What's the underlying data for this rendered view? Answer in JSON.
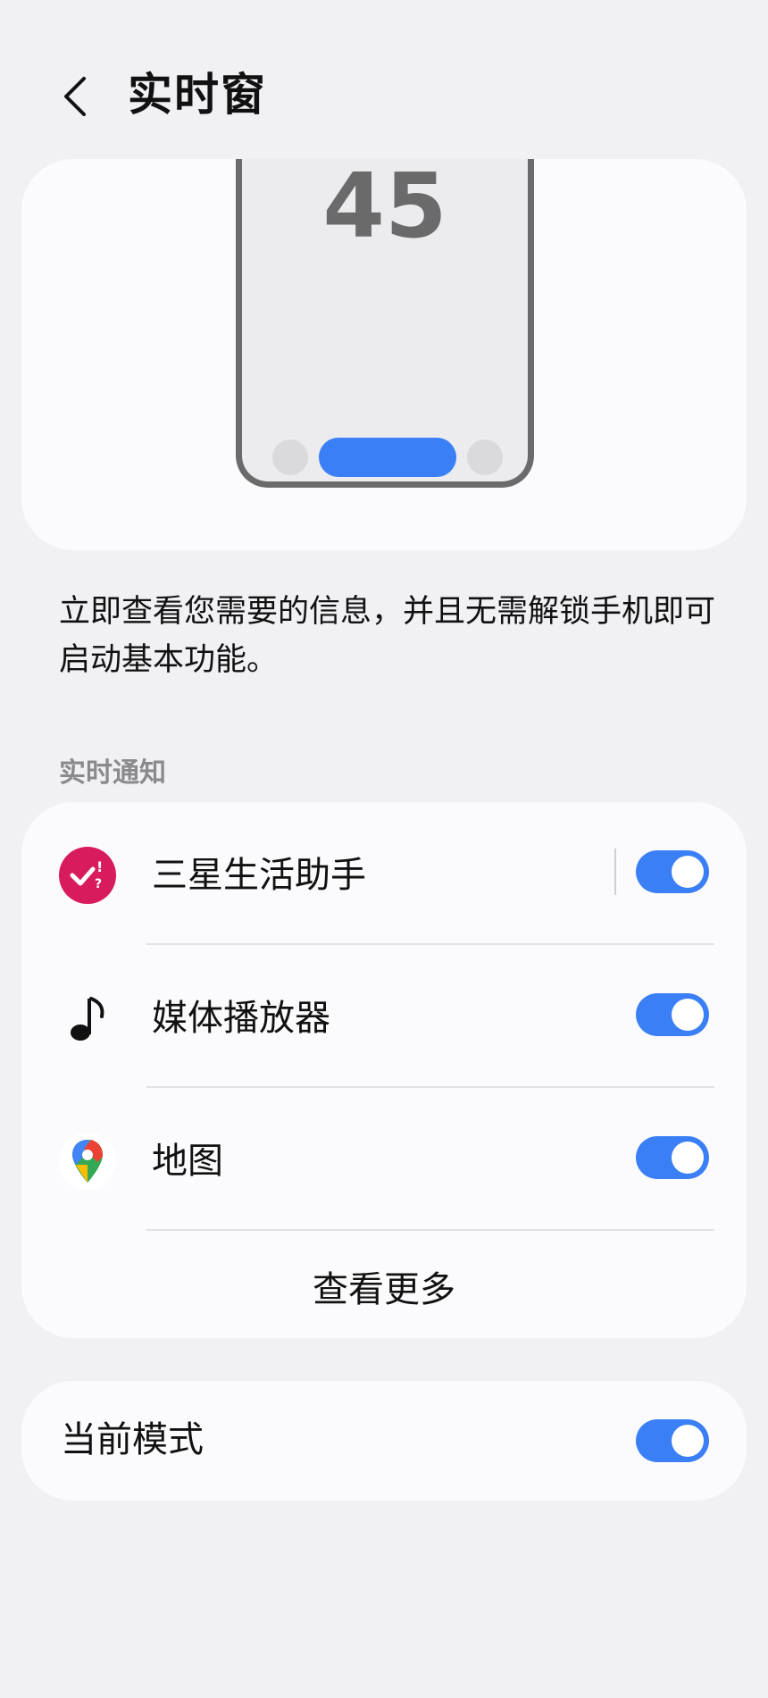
{
  "header": {
    "title": "实时窗",
    "back_icon": "chevron-left-icon"
  },
  "preview": {
    "clock_text": "45",
    "accent": "#3a7ff5"
  },
  "description": "立即查看您需要的信息，并且无需解锁手机即可启动基本功能。",
  "section": {
    "label": "实时通知"
  },
  "apps": [
    {
      "label": "三星生活助手",
      "icon": "samsung-life-assistant-icon",
      "enabled": true
    },
    {
      "label": "媒体播放器",
      "icon": "music-note-icon",
      "enabled": true
    },
    {
      "label": "地图",
      "icon": "google-maps-pin-icon",
      "enabled": true
    }
  ],
  "see_more": "查看更多",
  "current_mode": {
    "label": "当前模式",
    "enabled": true
  },
  "colors": {
    "toggle_on": "#3a7ff5",
    "background": "#f1f1f4",
    "card": "#fbfbfd"
  }
}
